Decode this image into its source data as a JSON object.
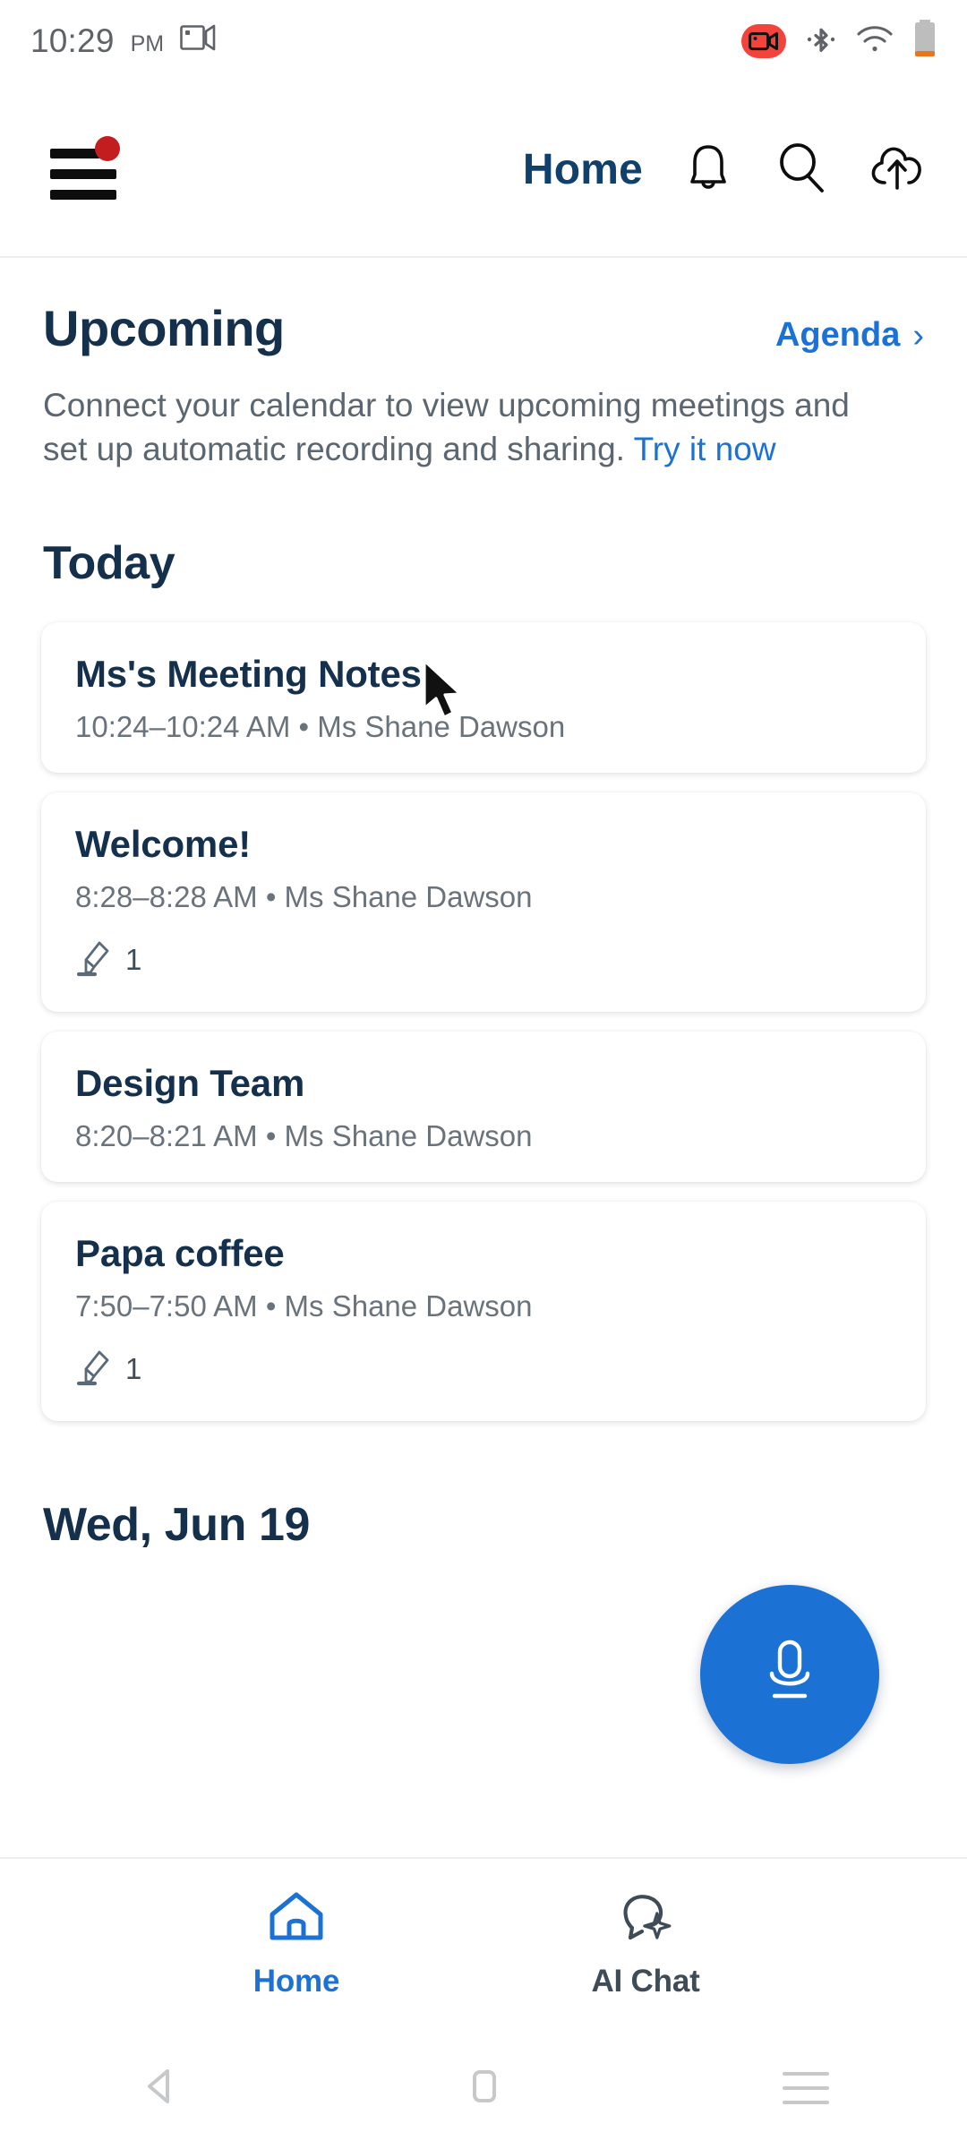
{
  "statusbar": {
    "time": "10:29",
    "ampm": "PM",
    "cast_icon": "screen-cast-icon",
    "recording_icon": "video-recording-icon",
    "bluetooth_icon": "bluetooth-icon",
    "wifi_icon": "wifi-icon",
    "battery_icon": "battery-icon",
    "recording_color": "#f4433a"
  },
  "header": {
    "menu_icon": "hamburger-menu-icon",
    "menu_badge": "notification-dot",
    "title": "Home",
    "bell_icon": "bell-icon",
    "search_icon": "search-icon",
    "upload_icon": "cloud-upload-icon",
    "title_color": "#10406c"
  },
  "upcoming": {
    "heading": "Upcoming",
    "agenda_label": "Agenda",
    "agenda_chevron": "›",
    "description_part1": "Connect your calendar to view upcoming meetings and set up automatic recording and sharing. ",
    "description_link": "Try it now"
  },
  "today": {
    "heading": "Today"
  },
  "cards": [
    {
      "title": "Ms's Meeting Notes",
      "subtitle": "10:24–10:24 AM •  Ms Shane Dawson",
      "has_meta": false,
      "meta_icon": "highlighter-icon",
      "meta_count": ""
    },
    {
      "title": "Welcome!",
      "subtitle": "8:28–8:28 AM •  Ms Shane Dawson",
      "has_meta": true,
      "meta_icon": "highlighter-icon",
      "meta_count": "1"
    },
    {
      "title": "Design Team",
      "subtitle": "8:20–8:21 AM •  Ms Shane Dawson",
      "has_meta": false,
      "meta_icon": "highlighter-icon",
      "meta_count": ""
    },
    {
      "title": "Papa coffee",
      "subtitle": "7:50–7:50 AM •  Ms Shane Dawson",
      "has_meta": true,
      "meta_icon": "highlighter-icon",
      "meta_count": "1"
    }
  ],
  "date_section": {
    "heading": "Wed, Jun 19"
  },
  "fab": {
    "icon": "microphone-icon",
    "color": "#1b72d4"
  },
  "bottom_nav": {
    "items": [
      {
        "label": "Home",
        "icon": "home-icon",
        "active": true
      },
      {
        "label": "AI Chat",
        "icon": "ai-chat-icon",
        "active": false
      }
    ],
    "active_color": "#1b72d4",
    "inactive_color": "#3f4b57"
  },
  "system_nav": {
    "back_icon": "back-triangle-icon",
    "home_icon": "home-square-icon",
    "recents_icon": "recents-lines-icon"
  },
  "cursor": {
    "icon": "mouse-pointer-icon"
  }
}
